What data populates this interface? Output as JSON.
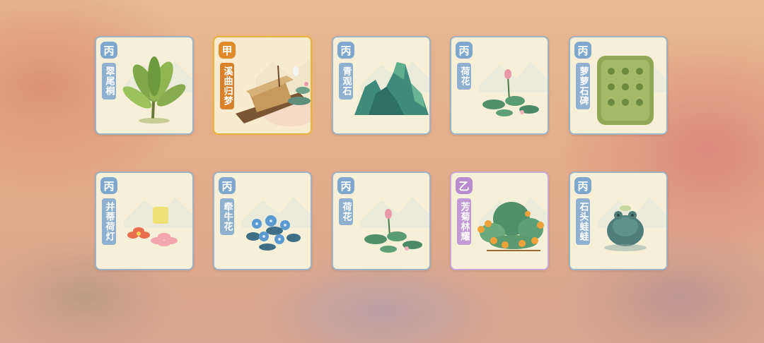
{
  "colors": {
    "common_rank": "#7fa7cd",
    "gold_rank": "#e08a2a",
    "purple_rank": "#b88ccf",
    "card_bg": "#f7f0d8"
  },
  "items": [
    {
      "rank": "丙",
      "name": "翠尾桐",
      "icon": "plant-icon"
    },
    {
      "rank": "甲",
      "name": "溪曲归梦",
      "icon": "boat-icon"
    },
    {
      "rank": "丙",
      "name": "青观石",
      "icon": "rock-icon"
    },
    {
      "rank": "丙",
      "name": "荷花",
      "icon": "lotus-icon"
    },
    {
      "rank": "丙",
      "name": "萝萝石碑",
      "icon": "stele-icon"
    },
    {
      "rank": "丙",
      "name": "并蒂荷灯",
      "icon": "lantern-icon"
    },
    {
      "rank": "丙",
      "name": "牵牛花",
      "icon": "morning-glory-icon"
    },
    {
      "rank": "丙",
      "name": "荷花",
      "icon": "lotus-icon"
    },
    {
      "rank": "乙",
      "name": "芳菊林耀",
      "icon": "chrysanthemum-icon"
    },
    {
      "rank": "丙",
      "name": "石头蛙蛙",
      "icon": "frog-icon"
    }
  ]
}
